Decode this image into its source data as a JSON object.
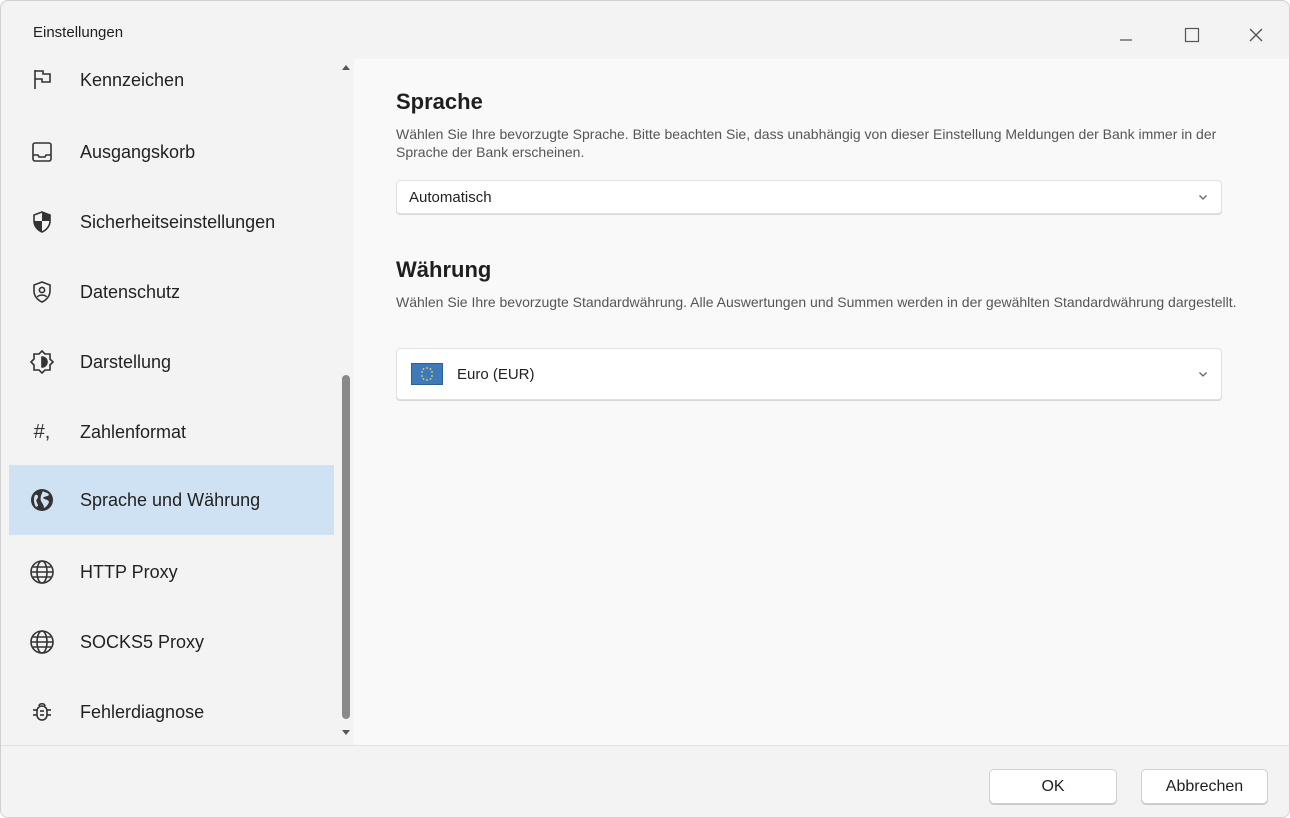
{
  "window": {
    "title": "Einstellungen",
    "controls": {
      "minimize": "—",
      "maximize": "☐",
      "close": "✕"
    }
  },
  "sidebar": {
    "items": [
      {
        "label": "Kennzeichen",
        "icon": "flag-icon"
      },
      {
        "label": "Ausgangskorb",
        "icon": "outbox-icon"
      },
      {
        "label": "Sicherheitseinstellungen",
        "icon": "shield-icon"
      },
      {
        "label": "Datenschutz",
        "icon": "privacy-shield-icon"
      },
      {
        "label": "Darstellung",
        "icon": "brightness-icon"
      },
      {
        "label": "Zahlenformat",
        "icon": "number-format-icon",
        "glyph": "#,"
      },
      {
        "label": "Sprache und Währung",
        "icon": "globe-filled-icon",
        "active": true
      },
      {
        "label": "HTTP Proxy",
        "icon": "globe-icon"
      },
      {
        "label": "SOCKS5 Proxy",
        "icon": "globe-icon"
      },
      {
        "label": "Fehlerdiagnose",
        "icon": "bug-icon"
      }
    ]
  },
  "main": {
    "language": {
      "title": "Sprache",
      "description": "Wählen Sie Ihre bevorzugte Sprache. Bitte beachten Sie, dass unabhängig von dieser Einstellung Meldungen der Bank immer in der Sprache der Bank erscheinen.",
      "selected": "Automatisch"
    },
    "currency": {
      "title": "Währung",
      "description": "Wählen Sie Ihre bevorzugte Standardwährung. Alle Auswertungen und Summen werden in der gewählten Standardwährung dargestellt.",
      "selected": "Euro (EUR)",
      "flag_icon": "eu-flag-icon"
    }
  },
  "footer": {
    "ok_label": "OK",
    "cancel_label": "Abbrechen"
  },
  "colors": {
    "active_nav": "#cfe2f3",
    "window_bg": "#f3f3f3",
    "content_bg": "#f9f9f9"
  }
}
